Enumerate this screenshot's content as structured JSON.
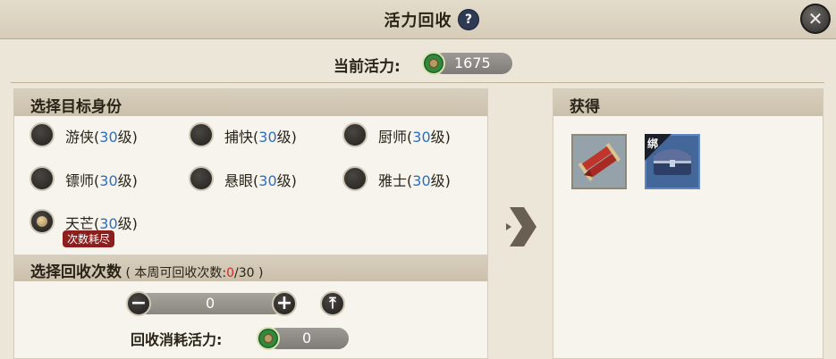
{
  "header": {
    "title": "活力回收",
    "help_icon": "?",
    "close_icon": "✕"
  },
  "vitality": {
    "label": "当前活力:",
    "value": "1675"
  },
  "identity": {
    "heading": "选择目标身份",
    "options": [
      {
        "name": "游侠",
        "level": "30",
        "selected": false
      },
      {
        "name": "捕快",
        "level": "30",
        "selected": false
      },
      {
        "name": "厨师",
        "level": "30",
        "selected": false
      },
      {
        "name": "镖师",
        "level": "30",
        "selected": false
      },
      {
        "name": "悬眼",
        "level": "30",
        "selected": false
      },
      {
        "name": "雅士",
        "level": "30",
        "selected": false
      },
      {
        "name": "天芒",
        "level": "30",
        "selected": true,
        "badge": "次数耗尽"
      }
    ],
    "level_open": "(",
    "level_suffix": "级)"
  },
  "recycle": {
    "heading": "选择回收次数",
    "weekly_prefix": "( 本周可回收次数:",
    "weekly_used": "0",
    "weekly_total": "/30 )",
    "count": "0",
    "minus": "−",
    "plus": "+",
    "max_icon": "⤒",
    "cost_label": "回收消耗活力:",
    "cost_value": "0"
  },
  "rewards": {
    "heading": "获得",
    "items": [
      {
        "icon": "scroll-bundle-icon"
      },
      {
        "icon": "treasure-chest-icon",
        "tag": "绑"
      }
    ]
  },
  "colors": {
    "level": "#2a6fc5",
    "exhausted_badge": "#8c1e1e",
    "count_used": "#d42a2a"
  }
}
